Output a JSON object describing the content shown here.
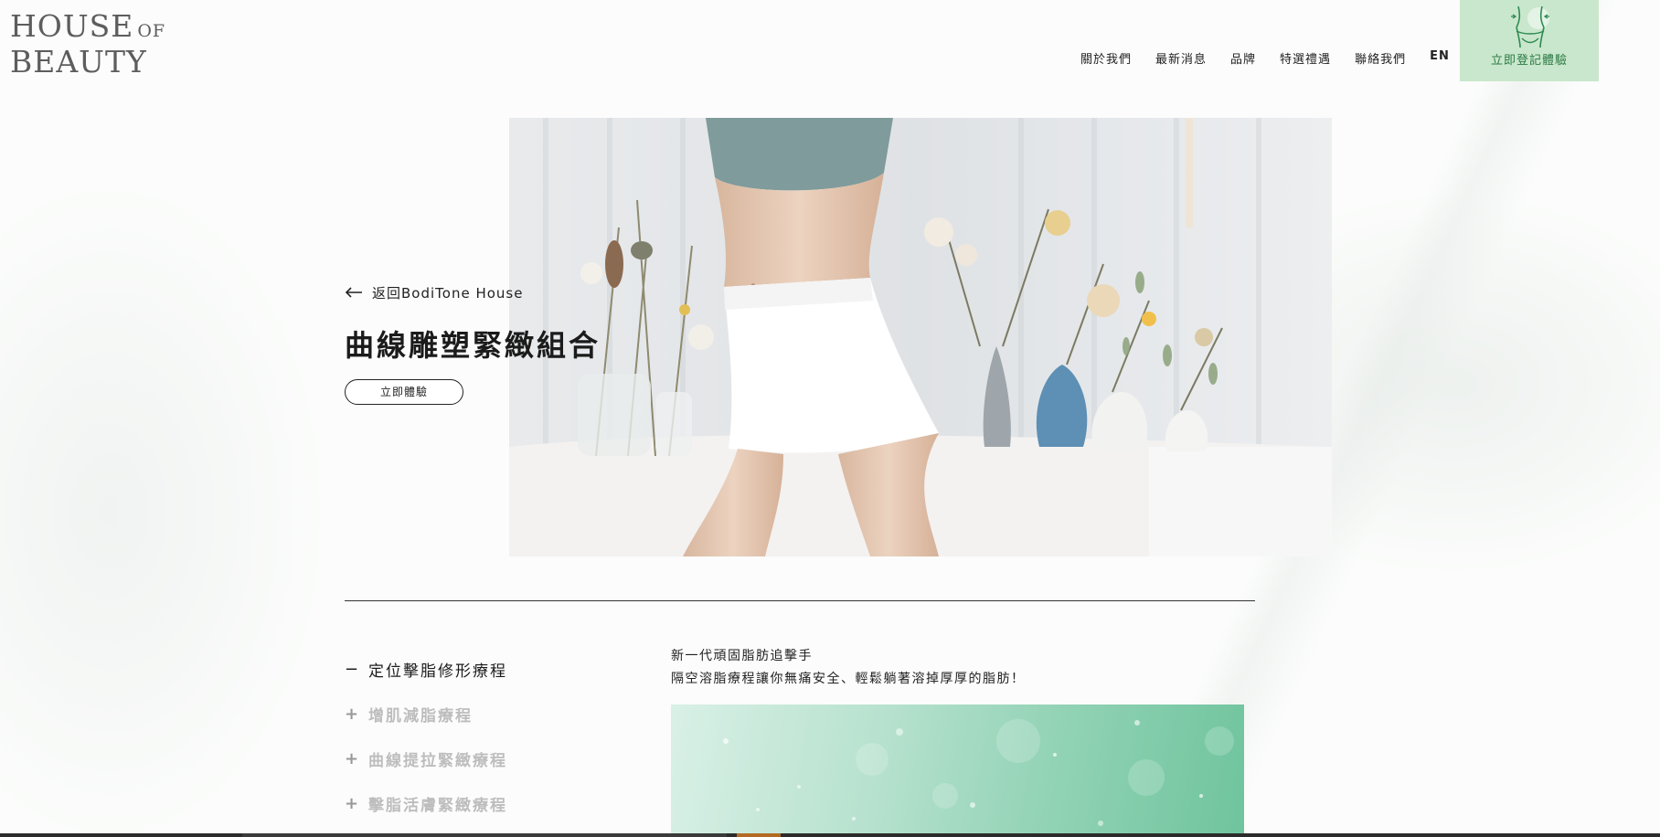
{
  "logo": {
    "line1": "HOUSE",
    "line1_small": "OF",
    "line2": "BEAUTY"
  },
  "nav": {
    "items": [
      "關於我們",
      "最新消息",
      "品牌",
      "特選禮遇",
      "聯絡我們"
    ],
    "lang": "EN"
  },
  "cta": {
    "label": "立即登記體驗",
    "icon": "body-silhouette-icon",
    "background": "#c9e7cc",
    "text_color": "#2c7a45"
  },
  "hero": {
    "back_link": "返回BodiTone House",
    "title": "曲線雕塑緊緻組合",
    "button": "立即體驗"
  },
  "treatments": {
    "items": [
      {
        "label": "定位擊脂修形療程",
        "active": true,
        "sign": "−"
      },
      {
        "label": "增肌減脂療程",
        "active": false,
        "sign": "+"
      },
      {
        "label": "曲線提拉緊緻療程",
        "active": false,
        "sign": "+"
      },
      {
        "label": "擊脂活膚緊緻療程",
        "active": false,
        "sign": "+"
      }
    ]
  },
  "description": {
    "line1": "新一代頑固脂肪追擊手",
    "line2": "隔空溶脂療程讓你無痛安全、輕鬆躺著溶掉厚厚的脂肪！"
  },
  "colors": {
    "accent_green": "#c9e7cc",
    "text_dark": "#1b1b1b",
    "inactive_text": "#bdbdbd"
  }
}
